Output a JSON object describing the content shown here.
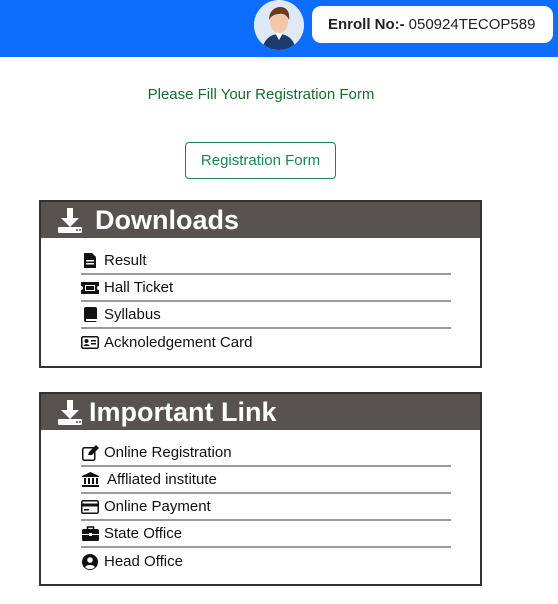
{
  "header": {
    "enroll_label": "Enroll No:-",
    "enroll_value": "050924TECOP589",
    "bar_color": "#0d6efd"
  },
  "notice": "Please Fill Your Registration Form",
  "registration_button": "Registration Form",
  "downloads": {
    "title": "Downloads",
    "icon": "download-icon",
    "items": [
      {
        "label": "Result",
        "icon": "file-icon"
      },
      {
        "label": "Hall Ticket",
        "icon": "ticket-icon"
      },
      {
        "label": "Syllabus",
        "icon": "book-icon"
      },
      {
        "label": "Acknoledgement Card",
        "icon": "id-card-icon"
      }
    ]
  },
  "important_links": {
    "title": "Important Link",
    "icon": "download-icon",
    "items": [
      {
        "label": "Online Registration",
        "icon": "edit-icon"
      },
      {
        "label": "Affliated institute",
        "icon": "institution-icon"
      },
      {
        "label": "Online Payment",
        "icon": "credit-card-icon"
      },
      {
        "label": "State Office",
        "icon": "briefcase-icon"
      },
      {
        "label": "Head Office",
        "icon": "user-circle-icon"
      }
    ]
  }
}
